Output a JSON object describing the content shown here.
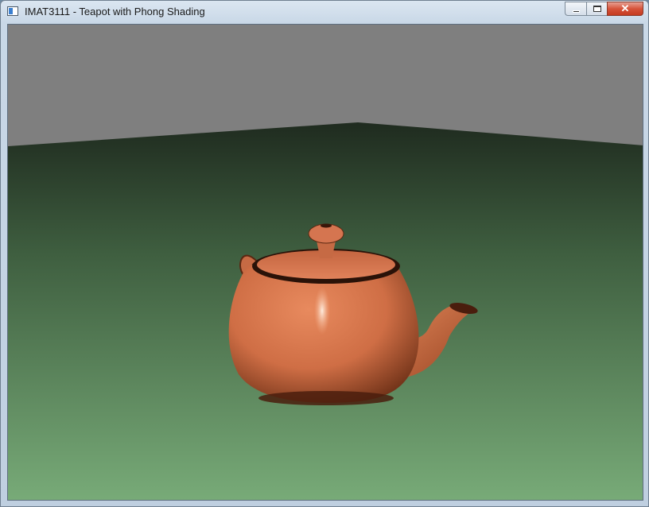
{
  "window": {
    "title": "IMAT3111 - Teapot with Phong Shading",
    "controls": {
      "minimize_icon": "minimize-icon",
      "maximize_icon": "maximize-icon",
      "close_icon": "close-icon"
    }
  },
  "scene": {
    "object": "teapot",
    "colors": {
      "background": "#7f7f7f",
      "floor_far": "#1f2b1f",
      "floor_near": "#78ab78",
      "teapot_base": "#d9784e",
      "teapot_shadow": "#5a2812",
      "highlight": "#ffe3cc"
    }
  }
}
